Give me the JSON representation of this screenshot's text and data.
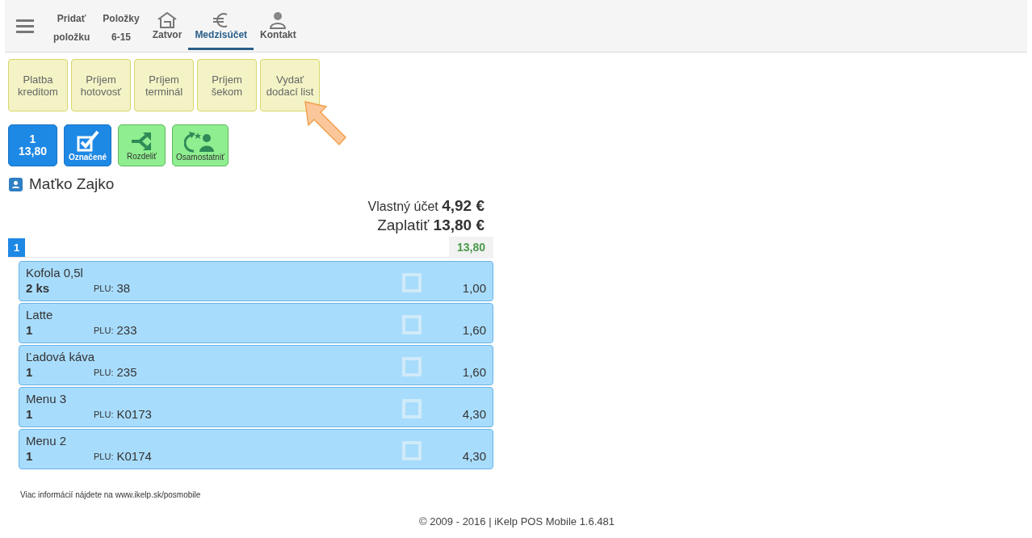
{
  "nav": [
    {
      "kind": "text",
      "lines": [
        "Pridať",
        "položku"
      ],
      "selected": false
    },
    {
      "kind": "text",
      "lines": [
        "Položky",
        "6-15"
      ],
      "selected": false
    },
    {
      "kind": "house",
      "lines": [
        "Zatvor"
      ],
      "selected": false
    },
    {
      "kind": "euro",
      "lines": [
        "Medzisúčet"
      ],
      "selected": true
    },
    {
      "kind": "person",
      "lines": [
        "Kontakt"
      ],
      "selected": false
    }
  ],
  "payment_buttons": [
    "Platba kreditom",
    "Príjem hotovosť",
    "Príjem terminál",
    "Príjem šekom",
    "Vydať dodací list"
  ],
  "actions": [
    {
      "kind": "count",
      "lines": [
        "1",
        "13,80"
      ]
    },
    {
      "kind": "check",
      "lines": [
        "Označené"
      ]
    },
    {
      "kind": "split",
      "lines": [
        "Rozdeliť"
      ]
    },
    {
      "kind": "separate",
      "lines": [
        "Osamostatniť"
      ]
    }
  ],
  "customer": "Maťko Zajko",
  "totals": [
    {
      "label": "Vlastný účet",
      "value": "4,92 €"
    },
    {
      "label": "Zaplatiť",
      "value": "13,80 €"
    }
  ],
  "group": {
    "number": "1",
    "sum": "13,80"
  },
  "items": [
    {
      "name": "Kofola 0,5l",
      "qty": "2 ks",
      "plu_label": "PLU:",
      "plu": "38",
      "checked": false,
      "price": "1,00"
    },
    {
      "name": "Latte",
      "qty": "1",
      "plu_label": "PLU:",
      "plu": "233",
      "checked": false,
      "price": "1,60"
    },
    {
      "name": "Ľadová káva",
      "qty": "1",
      "plu_label": "PLU:",
      "plu": "235",
      "checked": false,
      "price": "1,60"
    },
    {
      "name": "Menu 3",
      "qty": "1",
      "plu_label": "PLU:",
      "plu": "K0173",
      "checked": false,
      "price": "4,30"
    },
    {
      "name": "Menu 2",
      "qty": "1",
      "plu_label": "PLU:",
      "plu": "K0174",
      "checked": false,
      "price": "4,30"
    }
  ],
  "info": {
    "text": "Viac informácií nájdete na",
    "link": "www.ikelp.sk/posmobile"
  },
  "footer": "© 2009 - 2016 | iKelp POS Mobile 1.6.481"
}
